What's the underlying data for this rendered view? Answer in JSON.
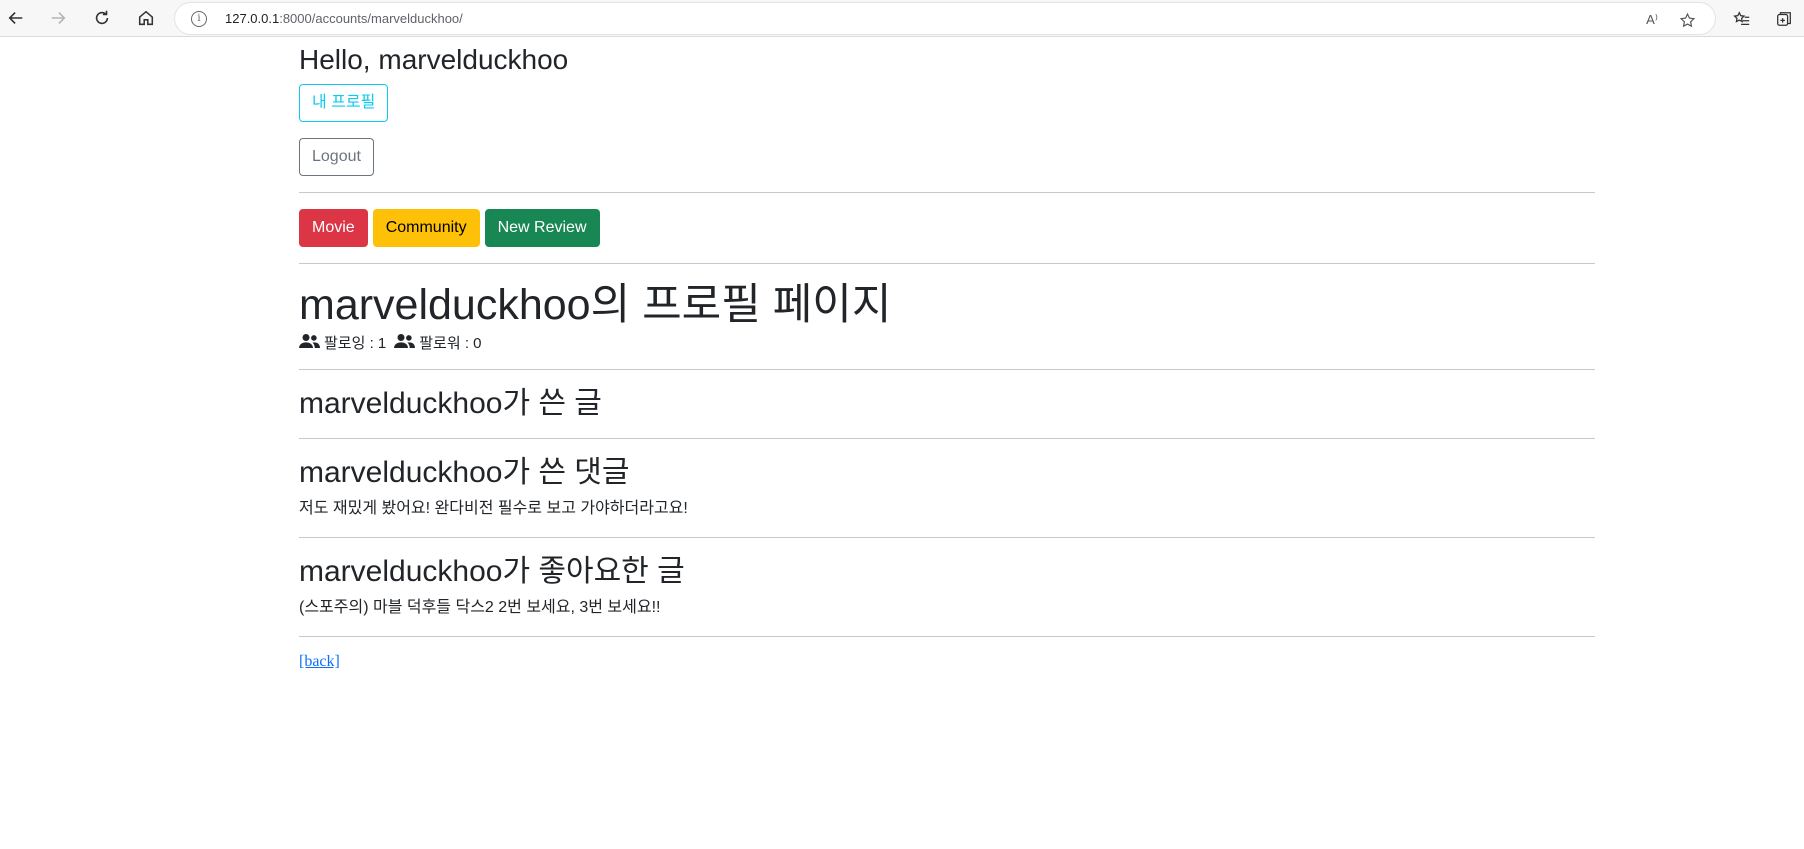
{
  "browser": {
    "url_host": "127.0.0.1",
    "url_rest": ":8000/accounts/marvelduckhoo/",
    "read_aloud_label": "A⁾"
  },
  "header": {
    "greeting": "Hello, marvelduckhoo",
    "my_profile_button": "내 프로필",
    "logout_button": "Logout"
  },
  "nav": {
    "movie": "Movie",
    "community": "Community",
    "new_review": "New Review"
  },
  "profile": {
    "title": "marvelduckhoo의 프로필 페이지",
    "following": "팔로잉 : 1",
    "followers": "팔로워 : 0"
  },
  "sections": {
    "posts_title": "marvelduckhoo가 쓴 글",
    "comments_title": "marvelduckhoo가 쓴 댓글",
    "comment_1": "저도 재밌게 봤어요! 완다비전 필수로 보고 가야하더라고요!",
    "liked_title": "marvelduckhoo가 좋아요한 글",
    "liked_1": "(스포주의) 마블 덕후들 닥스2 2번 보세요, 3번 보세요!!"
  },
  "footer": {
    "back_link": "[back]"
  },
  "colors": {
    "info": "#0dcaf0",
    "secondary": "#6c757d",
    "danger": "#dc3545",
    "warning": "#ffc107",
    "success": "#198754",
    "link": "#0d6efd"
  }
}
